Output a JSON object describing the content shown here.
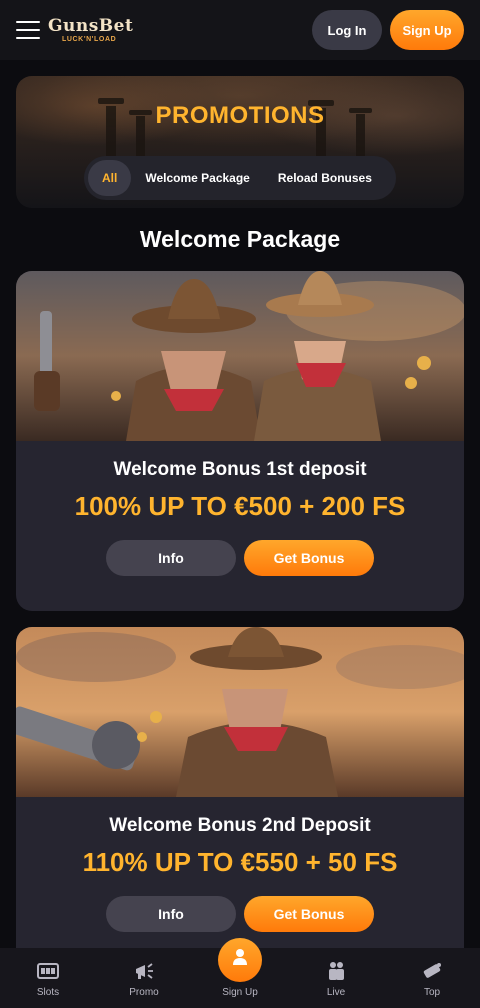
{
  "header": {
    "logo_main": "GunsBet",
    "logo_sub": "LUCK'N'LOAD",
    "login_label": "Log In",
    "signup_label": "Sign Up"
  },
  "promo": {
    "title": "PROMOTIONS",
    "filters": [
      "All",
      "Welcome Package",
      "Reload Bonuses"
    ],
    "active_filter": "All"
  },
  "section_title": "Welcome Package",
  "cards": [
    {
      "title": "Welcome Bonus 1st deposit",
      "offer": "100% UP TO €500 + 200 FS",
      "info_label": "Info",
      "get_label": "Get Bonus"
    },
    {
      "title": "Welcome Bonus 2nd Deposit",
      "offer": "110% UP TO €550 + 50 FS",
      "info_label": "Info",
      "get_label": "Get Bonus"
    }
  ],
  "bottom_nav": [
    {
      "label": "Slots",
      "icon": "slots-icon"
    },
    {
      "label": "Promo",
      "icon": "megaphone-icon"
    },
    {
      "label": "Sign Up",
      "icon": "user-icon"
    },
    {
      "label": "Live",
      "icon": "live-dealer-icon"
    },
    {
      "label": "Top",
      "icon": "top-games-icon"
    }
  ],
  "colors": {
    "accent": "#ffb42e",
    "button_gradient_start": "#ffa72b",
    "button_gradient_end": "#ff7a0a",
    "card_bg": "#262530",
    "page_bg": "#0c0c10"
  }
}
